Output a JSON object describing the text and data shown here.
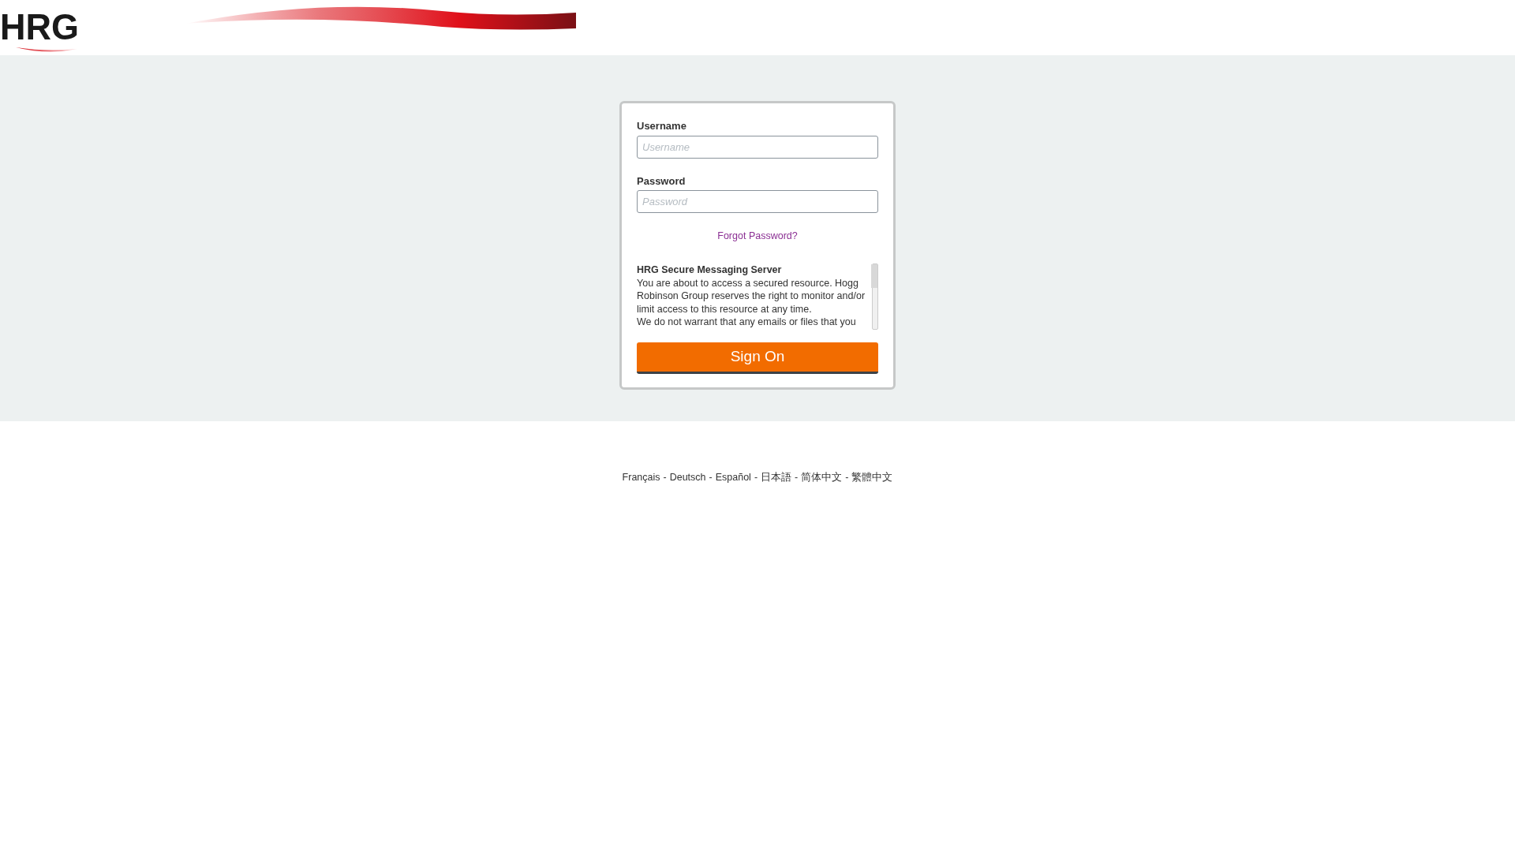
{
  "header": {
    "logo": "HRG"
  },
  "login": {
    "username": {
      "label": "Username",
      "placeholder": "Username"
    },
    "password": {
      "label": "Password",
      "placeholder": "Password"
    },
    "forgot_link": "Forgot Password?",
    "notice": {
      "title": "HRG Secure Messaging Server",
      "paragraphs": [
        "You are about to access a secured resource. Hogg Robinson Group reserves the right to monitor and/or limit access to this resource at any time.",
        "We do not warrant that any emails or files that you"
      ]
    },
    "submit": "Sign On"
  },
  "languages": {
    "separator": "-",
    "items": [
      "Français",
      "Deutsch",
      "Español",
      "日本語",
      "简体中文",
      "繁體中文"
    ]
  }
}
